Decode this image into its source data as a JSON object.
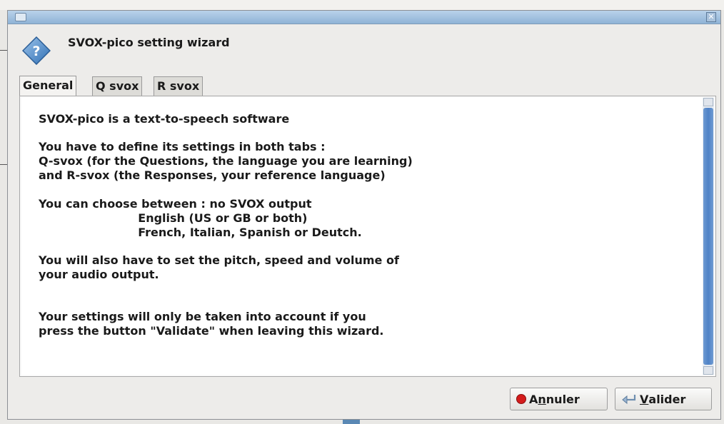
{
  "window": {
    "menu_icon": "window-menu-icon",
    "close_icon": "close-icon"
  },
  "header": {
    "icon": "help-diamond-icon",
    "title": "SVOX-pico setting wizard"
  },
  "tabs": [
    {
      "label": "General",
      "active": true
    },
    {
      "label": "Q svox",
      "active": false
    },
    {
      "label": "R svox",
      "active": false
    }
  ],
  "content": {
    "lines": [
      "SVOX-pico is a text-to-speech software",
      "You have to define its settings in both tabs :",
      "Q-svox (for the Questions, the language you are learning)",
      "and R-svox (the Responses, your reference language)",
      "You can choose between : no SVOX output",
      "                         English (US or GB or both)",
      "                         French, Italian, Spanish or Deutch.",
      "You will also have to set the pitch, speed and volume of",
      "your audio output.",
      "Your settings will only be taken into account if you",
      "press the button \"Validate\" when leaving this wizard."
    ]
  },
  "buttons": {
    "cancel": {
      "first": "A",
      "accel": "n",
      "rest": "nuler",
      "icon": "red-stop-icon"
    },
    "validate": {
      "accel": "V",
      "rest": "alider",
      "icon": "return-arrow-icon"
    }
  },
  "colors": {
    "titlebar": "#9dbde0",
    "scroll_thumb": "#5a8acb",
    "cancel_icon": "#d41c1c"
  }
}
